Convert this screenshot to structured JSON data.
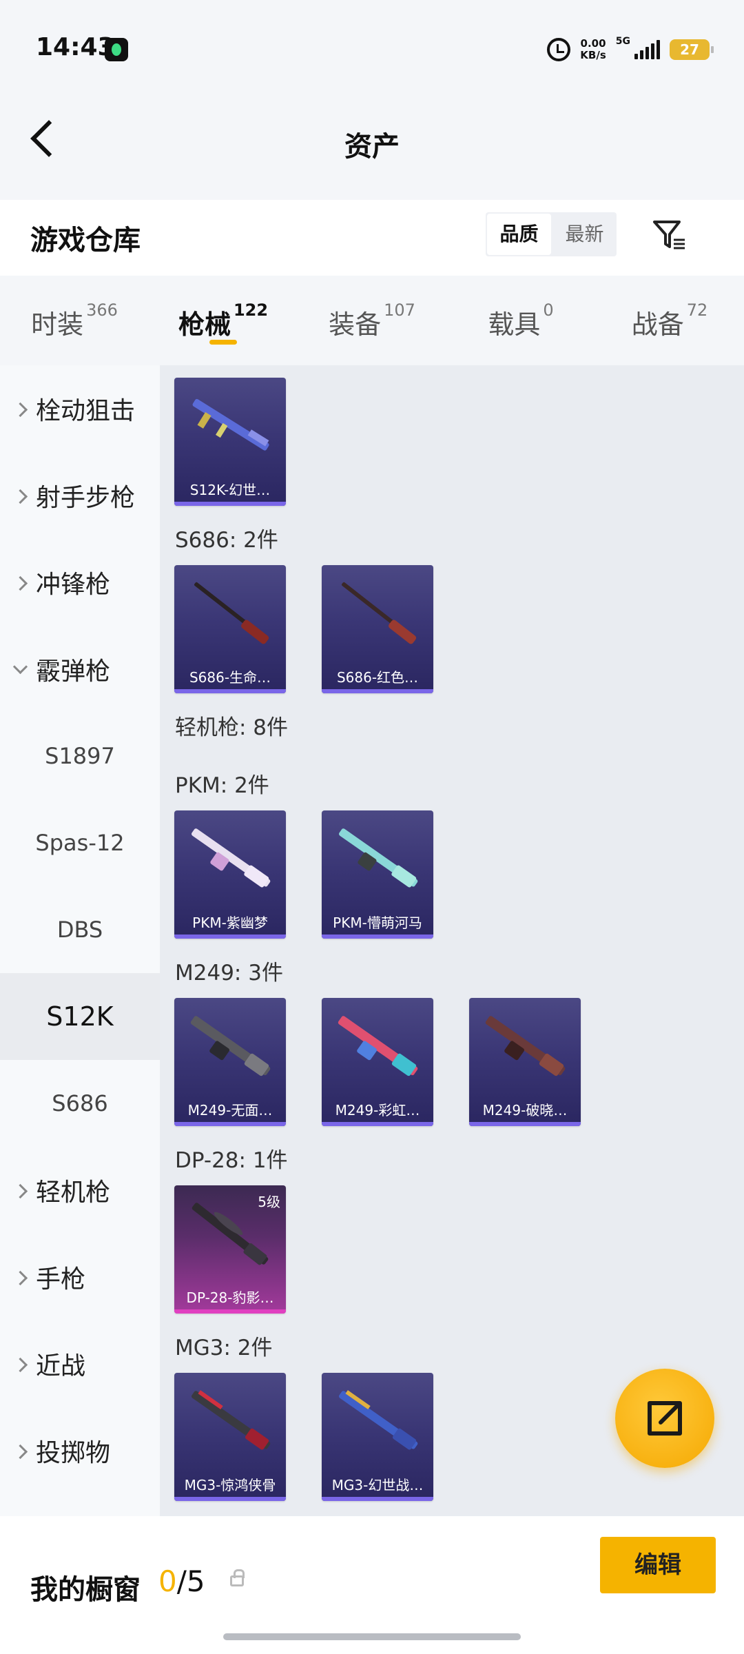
{
  "status_bar": {
    "time": "14:43",
    "net_speed_value": "0.00",
    "net_speed_unit": "KB/s",
    "network": "5G",
    "battery": "27"
  },
  "header": {
    "title": "资产",
    "back_icon": "back-arrow-icon"
  },
  "section": {
    "title": "游戏仓库",
    "sort_options": [
      "品质",
      "最新"
    ],
    "sort_selected": "品质",
    "filter_icon": "filter-icon"
  },
  "tabs": [
    {
      "label": "时装",
      "count": "366",
      "active": false
    },
    {
      "label": "枪械",
      "count": "122",
      "active": true
    },
    {
      "label": "装备",
      "count": "107",
      "active": false
    },
    {
      "label": "载具",
      "count": "0",
      "active": false
    },
    {
      "label": "战备",
      "count": "72",
      "active": false
    }
  ],
  "sidebar": [
    {
      "label": "栓动狙击",
      "type": "parent",
      "expanded": false
    },
    {
      "label": "射手步枪",
      "type": "parent",
      "expanded": false
    },
    {
      "label": "冲锋枪",
      "type": "parent",
      "expanded": false
    },
    {
      "label": "霰弹枪",
      "type": "parent",
      "expanded": true
    },
    {
      "label": "S1897",
      "type": "child"
    },
    {
      "label": "Spas-12",
      "type": "child"
    },
    {
      "label": "DBS",
      "type": "child"
    },
    {
      "label": "S12K",
      "type": "child",
      "active": true
    },
    {
      "label": "S686",
      "type": "child"
    },
    {
      "label": "轻机枪",
      "type": "parent",
      "expanded": false
    },
    {
      "label": "手枪",
      "type": "parent",
      "expanded": false
    },
    {
      "label": "近战",
      "type": "parent",
      "expanded": false
    },
    {
      "label": "投掷物",
      "type": "parent",
      "expanded": false
    }
  ],
  "content": {
    "groups": [
      {
        "title": "",
        "items": [
          {
            "label": "S12K-幻世…"
          }
        ]
      },
      {
        "title": "S686: 2件",
        "items": [
          {
            "label": "S686-生命…"
          },
          {
            "label": "S686-红色…"
          }
        ]
      },
      {
        "title": "轻机枪: 8件",
        "items": []
      },
      {
        "title": "PKM: 2件",
        "items": [
          {
            "label": "PKM-紫幽梦"
          },
          {
            "label": "PKM-懵萌河马"
          }
        ]
      },
      {
        "title": "M249: 3件",
        "items": [
          {
            "label": "M249-无面…"
          },
          {
            "label": "M249-彩虹…"
          },
          {
            "label": "M249-破晓…"
          }
        ]
      },
      {
        "title": "DP-28: 1件",
        "items": [
          {
            "label": "DP-28-豹影…",
            "level": "5级",
            "rarity": "pink"
          }
        ]
      },
      {
        "title": "MG3: 2件",
        "items": [
          {
            "label": "MG3-惊鸿侠骨"
          },
          {
            "label": "MG3-幻世战…"
          }
        ]
      }
    ]
  },
  "bottom_bar": {
    "label": "我的橱窗",
    "current": "0",
    "separator": "/",
    "max": "5",
    "edit_label": "编辑"
  },
  "fab_icon": "share-external-icon",
  "colors": {
    "accent": "#f5b300",
    "item_bg": "#3a3675",
    "rare_bg": "#a43a9c"
  }
}
